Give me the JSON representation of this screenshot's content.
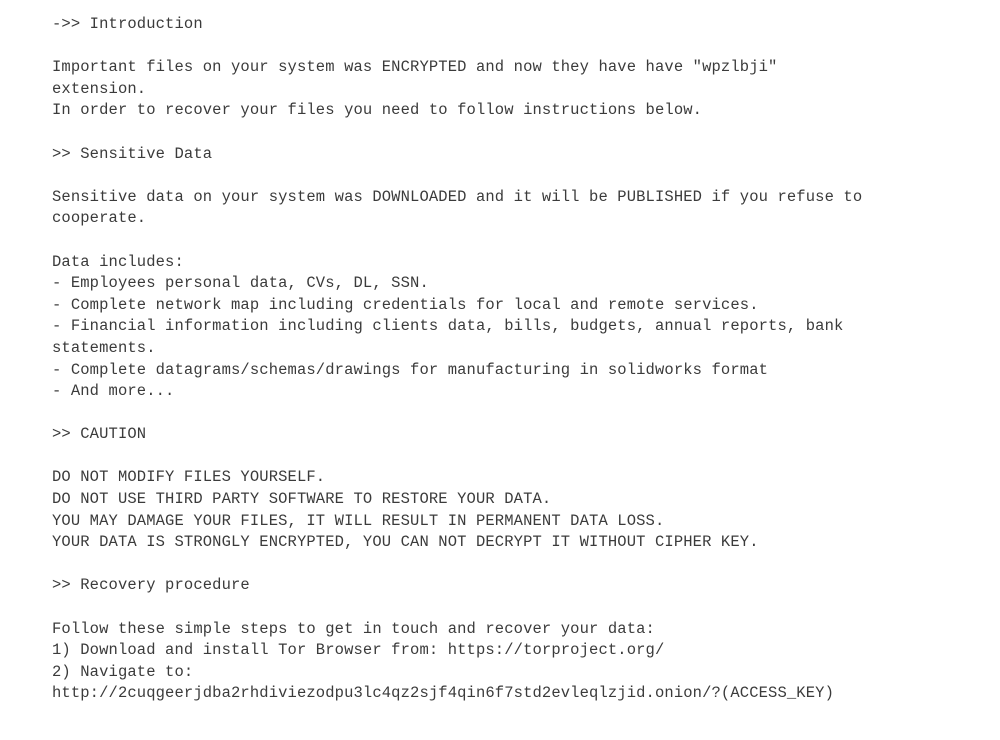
{
  "document": {
    "kind": "plain-text-ransom-note",
    "background_color": "#ffffff",
    "text_color": "#3b3b3b",
    "encrypted_extension": "wpzlbji",
    "tor_browser_url": "https://torproject.org/",
    "onion_url": "http://2cuqgeerjdba2rhdiviezodpu3lc4qz2sjf4qin6f7std2evleqlzjid.onion/?(ACCESS_KEY)",
    "lines": [
      "->> Introduction",
      "",
      "Important files on your system was ENCRYPTED and now they have have \"wpzlbji\"",
      "extension.",
      "In order to recover your files you need to follow instructions below.",
      "",
      ">> Sensitive Data",
      "",
      "Sensitive data on your system was DOWNLOADED and it will be PUBLISHED if you refuse to",
      "cooperate.",
      "",
      "Data includes:",
      "- Employees personal data, CVs, DL, SSN.",
      "- Complete network map including credentials for local and remote services.",
      "- Financial information including clients data, bills, budgets, annual reports, bank",
      "statements.",
      "- Complete datagrams/schemas/drawings for manufacturing in solidworks format",
      "- And more...",
      "",
      ">> CAUTION",
      "",
      "DO NOT MODIFY FILES YOURSELF.",
      "DO NOT USE THIRD PARTY SOFTWARE TO RESTORE YOUR DATA.",
      "YOU MAY DAMAGE YOUR FILES, IT WILL RESULT IN PERMANENT DATA LOSS.",
      "YOUR DATA IS STRONGLY ENCRYPTED, YOU CAN NOT DECRYPT IT WITHOUT CIPHER KEY.",
      "",
      ">> Recovery procedure",
      "",
      "Follow these simple steps to get in touch and recover your data:",
      "1) Download and install Tor Browser from: https://torproject.org/",
      "2) Navigate to:",
      "http://2cuqgeerjdba2rhdiviezodpu3lc4qz2sjf4qin6f7std2evleqlzjid.onion/?(ACCESS_KEY)"
    ],
    "sections": [
      {
        "heading": "->> Introduction"
      },
      {
        "heading": ">> Sensitive Data"
      },
      {
        "heading": ">> CAUTION"
      },
      {
        "heading": ">> Recovery procedure"
      }
    ]
  }
}
